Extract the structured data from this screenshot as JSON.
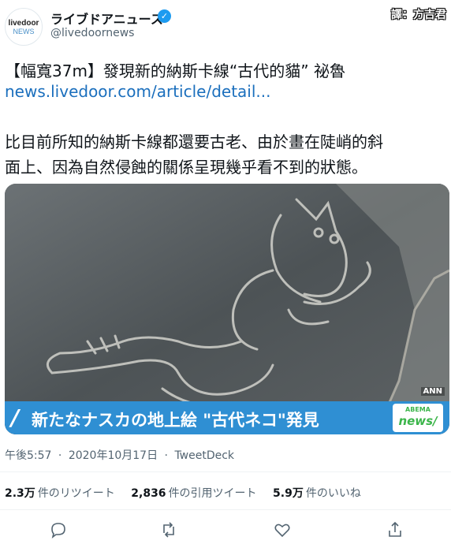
{
  "account": {
    "avatar_line1": "livedoor",
    "avatar_line2": "NEWS",
    "name": "ライブドアニュース",
    "handle": "@livedoornews"
  },
  "translator_credit": "譯：方吉君",
  "tweet": {
    "title": "【幅寬37m】發現新的納斯卡線“古代的貓” 祕魯",
    "link": "news.livedoor.com/article/detail...",
    "body_line1": "比目前所知的納斯卡線都還要古老、由於畫在陡峭的斜",
    "body_line2": "面上、因為自然侵蝕的關係呈現幾乎看不到的狀態。"
  },
  "media": {
    "watermark": "ANN",
    "caption_slash": "/",
    "caption": "新たなナスカの地上絵 \"古代ネコ\"発見",
    "badge_top": "ABEMA",
    "badge_main": "news/"
  },
  "meta": {
    "time": "午後5:57",
    "separator1": "·",
    "date": "2020年10月17日",
    "separator2": "·",
    "source": "TweetDeck"
  },
  "stats": [
    {
      "value": "2.3万",
      "label": "件のリツイート"
    },
    {
      "value": "2,836",
      "label": "件の引用ツイート"
    },
    {
      "value": "5.9万",
      "label": "件のいいね"
    }
  ],
  "colors": {
    "link": "#1b6fbd",
    "verified": "#1d9bf0",
    "caption_bar": "#2f8fd3"
  }
}
